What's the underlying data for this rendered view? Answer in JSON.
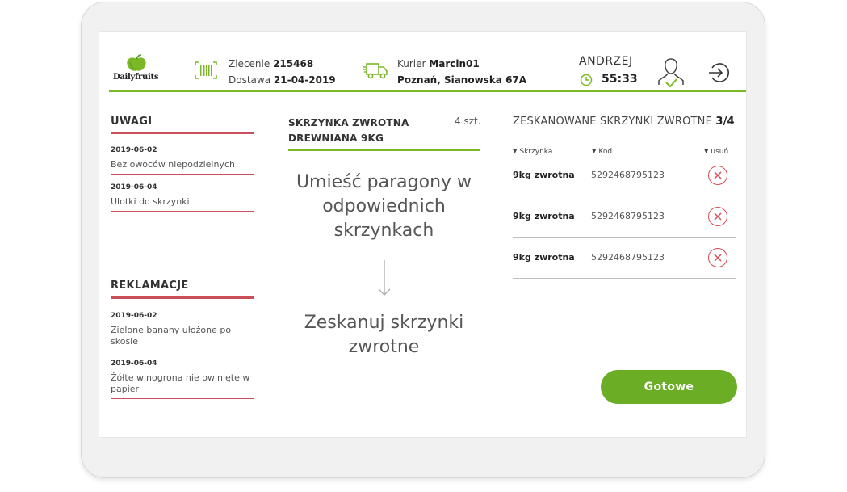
{
  "logo": {
    "text": "Dailyfruits"
  },
  "header": {
    "order_label": "Zlecenie",
    "order_number": "215468",
    "delivery_label": "Dostawa",
    "delivery_date": "21-04-2019",
    "courier_label": "Kurier",
    "courier_name": "Marcin01",
    "courier_address": "Poznań, Sianowska 67A",
    "user_name": "ANDRZEJ",
    "timer": "55:33"
  },
  "notes": {
    "title": "UWAGI",
    "items": [
      {
        "date": "2019-06-02",
        "text": "Bez owoców niepodzielnych"
      },
      {
        "date": "2019-06-04",
        "text": "Ulotki do skrzynki"
      }
    ]
  },
  "complaints": {
    "title": "REKLAMACJE",
    "items": [
      {
        "date": "2019-06-02",
        "text": "Zielone banany ułożone po skosie"
      },
      {
        "date": "2019-06-04",
        "text": "Żółte winogrona nie owinięte w papier"
      }
    ]
  },
  "box": {
    "title": "SKRZYNKA ZWROTNA DREWNIANA 9KG",
    "count": "4 szt.",
    "instruction_1": "Umieść paragony w odpowiednich skrzynkach",
    "instruction_2": "Zeskanuj skrzynki zwrotne"
  },
  "scanned": {
    "title": "ZESKANOWANE SKRZYNKI ZWROTNE",
    "progress": "3/4",
    "columns": {
      "type": "Skrzynka",
      "code": "Kod",
      "remove": "usuń"
    },
    "rows": [
      {
        "type": "9kg zwrotna",
        "code": "5292468795123"
      },
      {
        "type": "9kg zwrotna",
        "code": "5292468795123"
      },
      {
        "type": "9kg zwrotna",
        "code": "5292468795123"
      }
    ]
  },
  "done_button": "Gotowe",
  "colors": {
    "accent_green": "#7ab828",
    "button_green": "#6bae25",
    "alert_red": "#c9505b"
  },
  "icons": [
    "apple-logo-icon",
    "barcode-scan-icon",
    "truck-icon",
    "clock-icon",
    "user-check-icon",
    "logout-icon",
    "arrow-down-icon",
    "remove-x-icon"
  ]
}
